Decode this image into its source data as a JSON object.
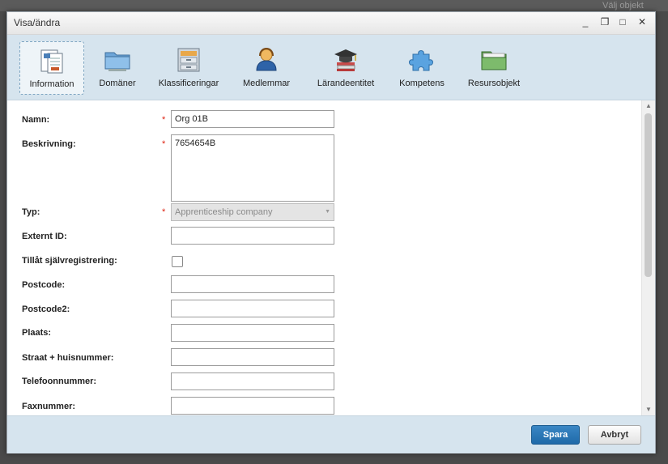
{
  "backdrop": {
    "text": "Välj objekt"
  },
  "window": {
    "title": "Visa/ändra",
    "controls": [
      "minimize-icon",
      "restore-icon",
      "maximize-icon",
      "close-icon"
    ],
    "minimize": "_",
    "restore": "❐",
    "maximize": "□",
    "close": "✕"
  },
  "tabs": [
    {
      "label": "Information",
      "icon": "information-icon",
      "active": true
    },
    {
      "label": "Domäner",
      "icon": "folder-icon"
    },
    {
      "label": "Klassificeringar",
      "icon": "filing-cabinet-icon"
    },
    {
      "label": "Medlemmar",
      "icon": "members-icon"
    },
    {
      "label": "Lärandeentitet",
      "icon": "graduation-books-icon"
    },
    {
      "label": "Kompetens",
      "icon": "puzzle-icon"
    },
    {
      "label": "Resursobjekt",
      "icon": "green-folder-icon"
    }
  ],
  "form": {
    "name": {
      "label": "Namn:",
      "value": "Org 01B",
      "required": true
    },
    "description": {
      "label": "Beskrivning:",
      "value": "7654654B",
      "required": true
    },
    "type": {
      "label": "Typ:",
      "value": "Apprenticeship company",
      "required": true,
      "disabled": true
    },
    "external_id": {
      "label": "Externt ID:",
      "value": ""
    },
    "self_registration": {
      "label": "Tillåt självregistrering:",
      "checked": false
    },
    "postcode": {
      "label": "Postcode:",
      "value": ""
    },
    "postcode2": {
      "label": "Postcode2:",
      "value": ""
    },
    "place": {
      "label": "Plaats:",
      "value": ""
    },
    "street": {
      "label": "Straat + huisnummer:",
      "value": ""
    },
    "phone": {
      "label": "Telefoonnummer:",
      "value": ""
    },
    "fax": {
      "label": "Faxnummer:",
      "value": ""
    },
    "required_marker": "*"
  },
  "footer": {
    "save_label": "Spara",
    "cancel_label": "Avbryt"
  },
  "colors": {
    "accent": "#2a78b8",
    "toolbar_bg": "#d6e4ee",
    "required": "#dd2211"
  }
}
